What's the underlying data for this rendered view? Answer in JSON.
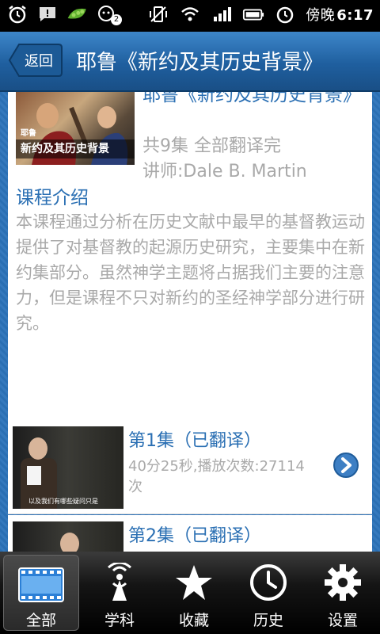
{
  "status_bar": {
    "notification_count": "2",
    "ampm": "傍晚",
    "time": "6:17"
  },
  "header": {
    "back_label": "返回",
    "title": "耶鲁《新约及其历史背景》"
  },
  "course": {
    "thumb_caption_small": "耶鲁",
    "thumb_caption": "新约及其历史背景",
    "title": "耶鲁《新约及其历史背景》",
    "episode_count": "共9集 全部翻译完",
    "teacher": "讲师:Dale B. Martin",
    "intro_heading": "课程介绍",
    "intro_body": "本课程通过分析在历史文献中最早的基督教运动提供了对基督教的起源历史研究，主要集中在新约集部分。虽然神学主题将占据我们主要的注意力，但是课程不只对新约的圣经神学部分进行研究。"
  },
  "episodes": [
    {
      "title": "第1集（已翻译）",
      "meta": "40分25秒,播放次数:27114次",
      "subtitle": "以及我们有哪些疑问只是"
    },
    {
      "title": "第2集（已翻译）"
    }
  ],
  "bottom_nav": [
    {
      "label": "全部",
      "icon": "film-icon"
    },
    {
      "label": "学科",
      "icon": "broadcast-icon"
    },
    {
      "label": "收藏",
      "icon": "star-icon"
    },
    {
      "label": "历史",
      "icon": "clock-icon"
    },
    {
      "label": "设置",
      "icon": "gear-icon"
    }
  ],
  "colors": {
    "accent": "#2a6fb3",
    "muted_text": "#a9a9a9"
  }
}
